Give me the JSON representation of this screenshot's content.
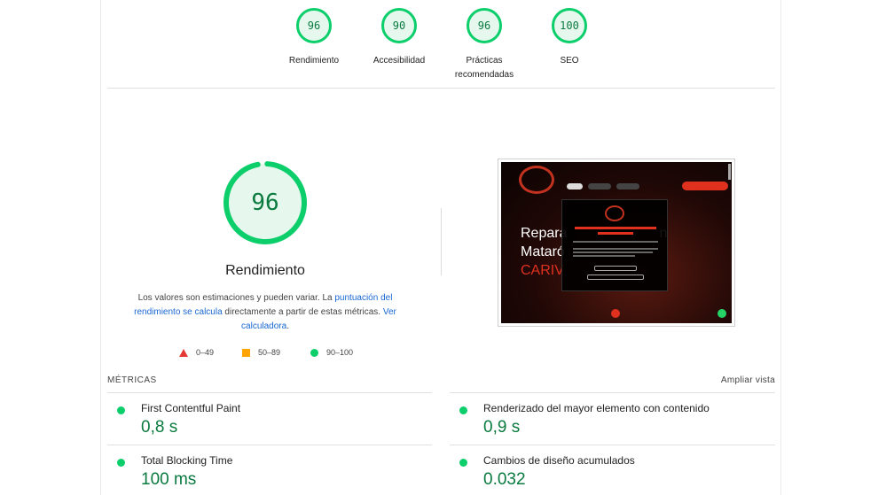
{
  "gauges": [
    {
      "score": "96",
      "label": "Rendimiento"
    },
    {
      "score": "90",
      "label": "Accesibilidad"
    },
    {
      "score": "96",
      "label": "Prácticas recomendadas"
    },
    {
      "score": "100",
      "label": "SEO"
    }
  ],
  "performance": {
    "score": "96",
    "score_fraction": 0.96,
    "title": "Rendimiento",
    "desc_1": "Los valores son estimaciones y pueden variar. La ",
    "desc_link_1": "puntuación del rendimiento se calcula",
    "desc_2": " directamente a partir de estas métricas. ",
    "desc_link_2": "Ver calculadora",
    "desc_3": "."
  },
  "legend": {
    "fail": "0–49",
    "average": "50–89",
    "pass": "90–100"
  },
  "thumbnail": {
    "heading_line1": "Repara",
    "heading_line1b": "n",
    "heading_line2": "Mataró",
    "heading_line3": "CARIV"
  },
  "metrics": {
    "title": "MÉTRICAS",
    "expand_label": "Ampliar vista",
    "items": [
      {
        "label": "First Contentful Paint",
        "value": "0,8 s"
      },
      {
        "label": "Renderizado del mayor elemento con contenido",
        "value": "0,9 s"
      },
      {
        "label": "Total Blocking Time",
        "value": "100 ms"
      },
      {
        "label": "Cambios de diseño acumulados",
        "value": "0.032"
      }
    ]
  },
  "colors": {
    "pass": "#0cce6b",
    "pass_text": "#0a7a3f",
    "pass_bg": "#e6f8ee",
    "average": "#ffa400",
    "fail": "#e53935",
    "link": "#1967d2"
  }
}
